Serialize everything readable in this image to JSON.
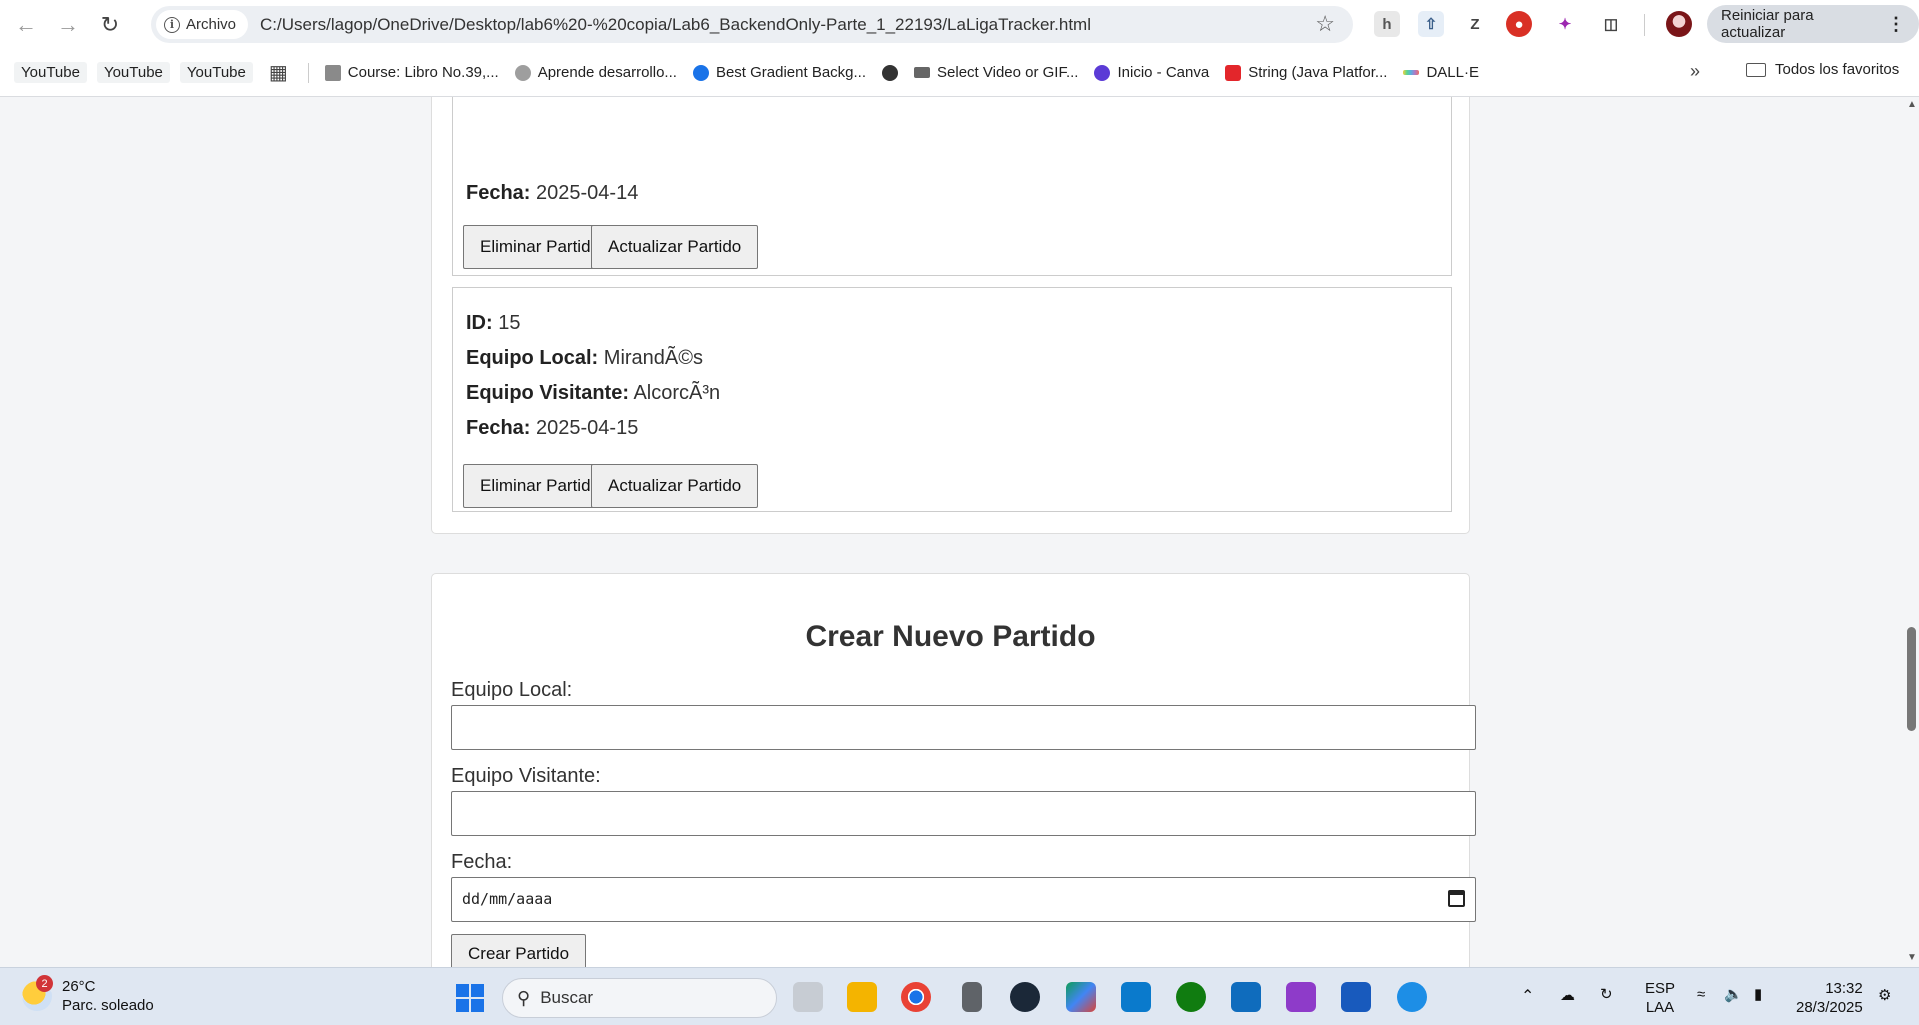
{
  "browser": {
    "site_chip": "Archivo",
    "url": "C:/Users/lagop/OneDrive/Desktop/lab6%20-%20copia/Lab6_BackendOnly-Parte_1_22193/LaLigaTracker.html",
    "update_button": "Reiniciar para actualizar"
  },
  "bookmarks": {
    "youtube_1": "YouTube",
    "youtube_2": "YouTube",
    "youtube_3": "YouTube",
    "items": [
      "Course: Libro No.39,...",
      "Aprende desarrollo...",
      "Best Gradient Backg...",
      "",
      "Select Video or GIF...",
      "Inicio - Canva",
      "String (Java Platfor...",
      "DALL·E"
    ],
    "all_favorites": "Todos los favoritos"
  },
  "labels": {
    "id": "ID:",
    "local": "Equipo Local:",
    "visitor": "Equipo Visitante:",
    "date": "Fecha:",
    "delete": "Eliminar Partido",
    "update": "Actualizar Partido"
  },
  "prev_match": {
    "date": "2025-04-14"
  },
  "match": {
    "id": "15",
    "local": "MirandÃ©s",
    "visitor": "AlcorcÃ³n",
    "date": "2025-04-15"
  },
  "form": {
    "title": "Crear Nuevo Partido",
    "local_label": "Equipo Local:",
    "visitor_label": "Equipo Visitante:",
    "date_label": "Fecha:",
    "date_placeholder": "dd/mm/aaaa",
    "submit": "Crear Partido"
  },
  "taskbar": {
    "weather_temp": "26°C",
    "weather_desc": "Parc. soleado",
    "weather_badge": "2",
    "search": "Buscar",
    "lang_1": "ESP",
    "lang_2": "LAA",
    "time": "13:32",
    "date": "28/3/2025"
  },
  "colors": {
    "accent": "#1a73e8",
    "card_border": "#dddddd"
  }
}
